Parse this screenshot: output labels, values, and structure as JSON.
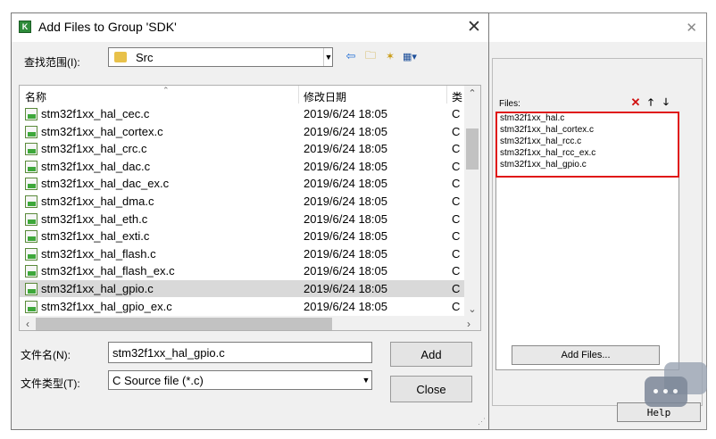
{
  "main_dialog": {
    "title": "Add Files to Group 'SDK'",
    "look_in_label": "查找范围(I):",
    "look_in_value": "Src",
    "columns": {
      "name": "名称",
      "date": "修改日期",
      "type": "类"
    },
    "files": [
      {
        "name": "stm32f1xx_hal_cec.c",
        "date": "2019/6/24 18:05",
        "type": "C"
      },
      {
        "name": "stm32f1xx_hal_cortex.c",
        "date": "2019/6/24 18:05",
        "type": "C"
      },
      {
        "name": "stm32f1xx_hal_crc.c",
        "date": "2019/6/24 18:05",
        "type": "C"
      },
      {
        "name": "stm32f1xx_hal_dac.c",
        "date": "2019/6/24 18:05",
        "type": "C"
      },
      {
        "name": "stm32f1xx_hal_dac_ex.c",
        "date": "2019/6/24 18:05",
        "type": "C"
      },
      {
        "name": "stm32f1xx_hal_dma.c",
        "date": "2019/6/24 18:05",
        "type": "C"
      },
      {
        "name": "stm32f1xx_hal_eth.c",
        "date": "2019/6/24 18:05",
        "type": "C"
      },
      {
        "name": "stm32f1xx_hal_exti.c",
        "date": "2019/6/24 18:05",
        "type": "C"
      },
      {
        "name": "stm32f1xx_hal_flash.c",
        "date": "2019/6/24 18:05",
        "type": "C"
      },
      {
        "name": "stm32f1xx_hal_flash_ex.c",
        "date": "2019/6/24 18:05",
        "type": "C"
      },
      {
        "name": "stm32f1xx_hal_gpio.c",
        "date": "2019/6/24 18:05",
        "type": "C",
        "selected": true
      },
      {
        "name": "stm32f1xx_hal_gpio_ex.c",
        "date": "2019/6/24 18:05",
        "type": "C"
      }
    ],
    "filename_label": "文件名(N):",
    "filename_value": "stm32f1xx_hal_gpio.c",
    "filetype_label": "文件类型(T):",
    "filetype_value": "C Source file (*.c)",
    "add_label": "Add",
    "close_label": "Close"
  },
  "background_dialog": {
    "files_label": "Files:",
    "files": [
      "stm32f1xx_hal.c",
      "stm32f1xx_hal_cortex.c",
      "stm32f1xx_hal_rcc.c",
      "stm32f1xx_hal_rcc_ex.c",
      "stm32f1xx_hal_gpio.c"
    ],
    "add_files_label": "Add Files...",
    "help_label": "Help"
  },
  "colors": {
    "highlight_border": "#e01818",
    "selected_row": "#d9d9d9",
    "dialog_bg": "#f0f0f0"
  },
  "icons": [
    "app-icon",
    "folder-icon",
    "back-icon",
    "up-folder-icon",
    "new-folder-icon",
    "view-menu-icon",
    "c-file-icon",
    "delete-icon",
    "move-up-icon",
    "move-down-icon",
    "close-icon"
  ]
}
